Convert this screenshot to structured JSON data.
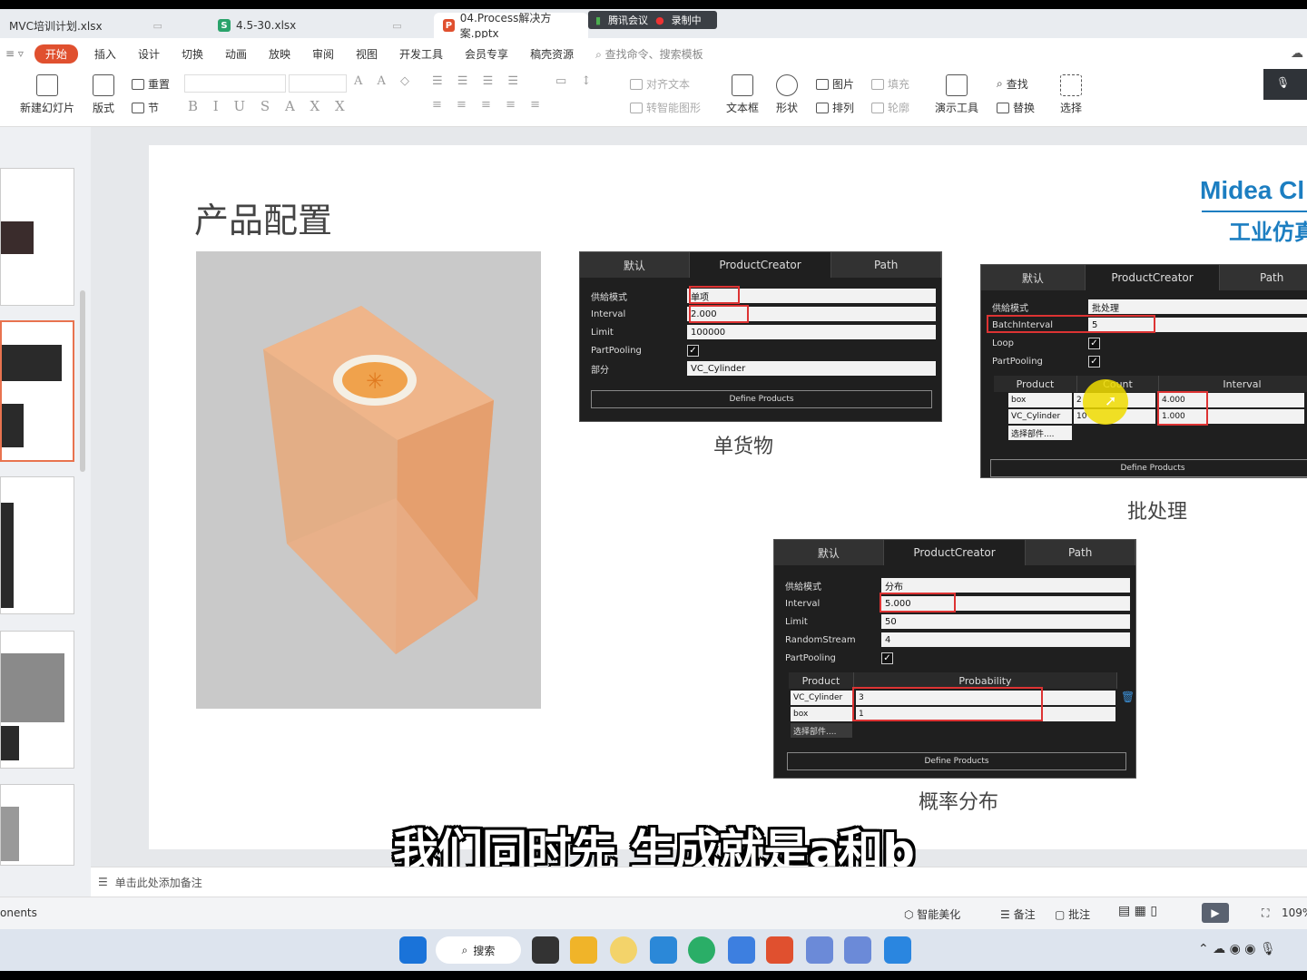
{
  "tabs": [
    {
      "name": "MVC培训计划.xlsx",
      "icon": "S"
    },
    {
      "name": "4.5-30.xlsx",
      "icon": "S"
    },
    {
      "name": "04.Process解决方案.pptx",
      "icon": "P"
    }
  ],
  "meeting": {
    "app": "腾讯会议",
    "status": "录制中"
  },
  "menu": {
    "items": [
      "开始",
      "插入",
      "设计",
      "切换",
      "动画",
      "放映",
      "审阅",
      "视图",
      "开发工具",
      "会员专享",
      "稿壳资源"
    ],
    "search": "查找命令、搜索模板"
  },
  "ribbon": {
    "new_slide": "新建幻灯片",
    "layout": "版式",
    "reset": "重置",
    "section": "节",
    "align_text": "对齐文本",
    "smart_shape": "转智能图形",
    "textbox": "文本框",
    "shape": "形状",
    "picture": "图片",
    "arrange": "排列",
    "fill": "填充",
    "outline": "轮廓",
    "present_tools": "演示工具",
    "find": "查找",
    "replace": "替换",
    "select": "选择"
  },
  "slide": {
    "title": "产品配置",
    "brand": "Midea Cl",
    "brand_cn": "工业仿真",
    "panel1": {
      "tabs": [
        "默认",
        "ProductCreator",
        "Path"
      ],
      "rows": [
        {
          "label": "供給模式",
          "value": "单项"
        },
        {
          "label": "Interval",
          "value": "2.000"
        },
        {
          "label": "Limit",
          "value": "100000"
        },
        {
          "label": "PartPooling",
          "value": "✓"
        },
        {
          "label": "部分",
          "value": "VC_Cylinder"
        }
      ],
      "button": "Define Products",
      "caption": "单货物"
    },
    "panel2": {
      "tabs": [
        "默认",
        "ProductCreator",
        "Path"
      ],
      "rows": [
        {
          "label": "供給模式",
          "value": "批处理"
        },
        {
          "label": "BatchInterval",
          "value": "5"
        },
        {
          "label": "Loop",
          "value": "✓"
        },
        {
          "label": "PartPooling",
          "value": "✓"
        }
      ],
      "grid_headers": [
        "Product",
        "Count",
        "Interval"
      ],
      "grid_rows": [
        {
          "product": "box",
          "count": "2",
          "interval": "4.000"
        },
        {
          "product": "VC_Cylinder",
          "count": "10",
          "interval": "1.000"
        },
        {
          "product": "选择部件....",
          "count": "",
          "interval": ""
        }
      ],
      "button": "Define Products",
      "caption": "批处理"
    },
    "panel3": {
      "tabs": [
        "默认",
        "ProductCreator",
        "Path"
      ],
      "rows": [
        {
          "label": "供給模式",
          "value": "分布"
        },
        {
          "label": "Interval",
          "value": "5.000"
        },
        {
          "label": "Limit",
          "value": "50"
        },
        {
          "label": "RandomStream",
          "value": "4"
        },
        {
          "label": "PartPooling",
          "value": "✓"
        }
      ],
      "grid_headers": [
        "Product",
        "Probability"
      ],
      "grid_rows": [
        {
          "product": "VC_Cylinder",
          "prob": "3"
        },
        {
          "product": "box",
          "prob": "1"
        },
        {
          "product": "选择部件....",
          "prob": ""
        }
      ],
      "button": "Define Products",
      "caption": "概率分布"
    }
  },
  "subtitle": "我们同时先 生成就是a和b",
  "notes_placeholder": "单击此处添加备注",
  "status": {
    "left": "onents",
    "beautify": "智能美化",
    "notes": "备注",
    "comment": "批注",
    "zoom": "109%"
  },
  "taskbar": {
    "search": "搜索"
  },
  "colors": {
    "accent": "#e0502f",
    "red_highlight": "#dd3333",
    "brand_blue": "#1c7ec1"
  }
}
